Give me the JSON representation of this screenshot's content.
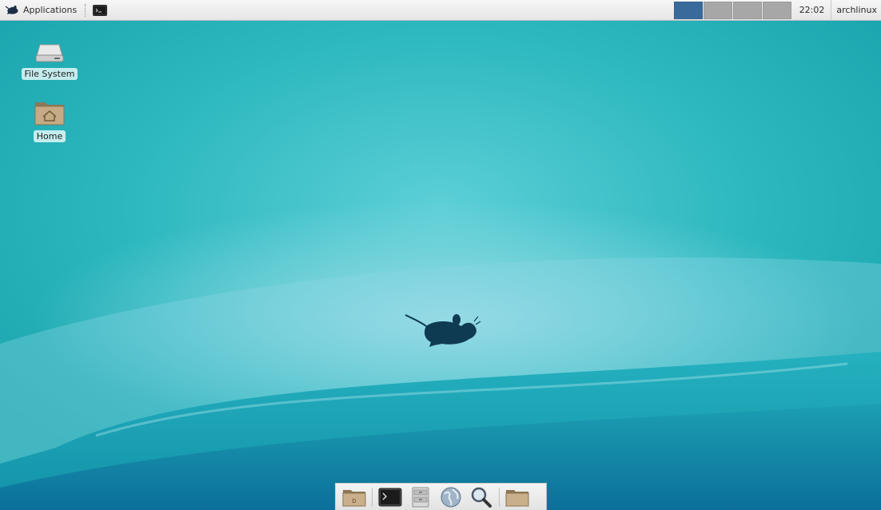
{
  "top_panel": {
    "applications_label": "Applications",
    "applications_icon": "xfce-mouse-icon",
    "taskbar_icon": "terminal-icon",
    "workspaces": [
      {
        "active": true
      },
      {
        "active": false
      },
      {
        "active": false
      },
      {
        "active": false
      }
    ],
    "clock": "22:02",
    "username": "archlinux"
  },
  "desktop_icons": [
    {
      "label": "File System",
      "icon": "drive-icon"
    },
    {
      "label": "Home",
      "icon": "home-folder-icon"
    }
  ],
  "dock": {
    "items": [
      {
        "icon": "show-desktop-icon"
      },
      {
        "icon": "terminal-icon"
      },
      {
        "icon": "file-manager-icon"
      },
      {
        "icon": "web-browser-icon"
      },
      {
        "icon": "search-icon"
      },
      {
        "icon": "folder-icon"
      }
    ]
  },
  "colors": {
    "panel_bg": "#eeeeee",
    "workspace_active": "#3a6a9c",
    "workspace_inactive": "#a7a7a7",
    "wallpaper_teal": "#2db8bf",
    "mouse_dark": "#0f3b52"
  }
}
